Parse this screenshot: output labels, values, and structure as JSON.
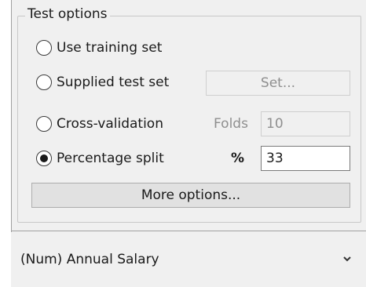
{
  "test_options": {
    "title": "Test options",
    "options": [
      {
        "label": "Use training set",
        "selected": false
      },
      {
        "label": "Supplied test set",
        "selected": false
      },
      {
        "label": "Cross-validation",
        "selected": false
      },
      {
        "label": "Percentage split",
        "selected": true
      }
    ],
    "set_button_label": "Set...",
    "folds_label": "Folds",
    "folds_value": "10",
    "percent_label": "%",
    "percent_value": "33",
    "more_options_label": "More options..."
  },
  "class_selector": {
    "value": "(Num) Annual Salary",
    "icon": "chevron-down-icon"
  }
}
